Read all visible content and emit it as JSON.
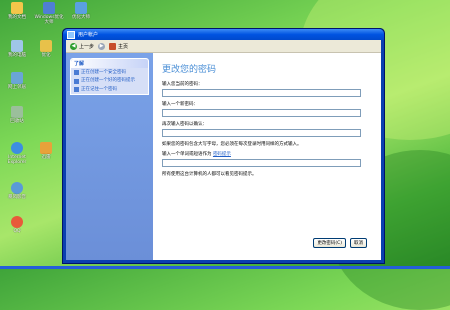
{
  "desktop": {
    "icons": [
      {
        "label": "我的文档",
        "color": "#f3c64a"
      },
      {
        "label": "Windows优化大师",
        "color": "#4f7fd4"
      },
      {
        "label": "优化大师",
        "color": "#5aa0e0"
      },
      {
        "label": "我的电脑",
        "color": "#9fc6e8"
      },
      {
        "label": "优化",
        "color": "#e8c14a"
      },
      {
        "label": "网上邻居",
        "color": "#6aa5d6"
      },
      {
        "label": "回收站",
        "color": "#9bbf9b"
      },
      {
        "label": "Internet Explorer",
        "color": "#3d8ee0"
      },
      {
        "label": "迅雷",
        "color": "#e8a23a"
      },
      {
        "label": "暴风影音",
        "color": "#5a9ad8"
      },
      {
        "label": "QQ",
        "color": "#e85a3a"
      }
    ]
  },
  "window": {
    "title": "用户帐户",
    "toolbar": {
      "back_label": "上一步",
      "home_label": "主页"
    },
    "task_pane": {
      "header": "了解",
      "items": [
        "正在创建一个安全密码",
        "正在创建一个好的密码提示",
        "正在记住一个密码"
      ]
    },
    "main": {
      "heading": "更改您的密码",
      "current_password_label": "输入您当前的密码：",
      "new_password_label": "输入一个新密码：",
      "confirm_password_label": "再次输入密码以确认：",
      "case_info": "如果您的密码包含大写字母，您必须在每次登录时用同样的方式输入。",
      "hint_label": "输入一个单词或短语作为",
      "hint_link": "密码提示",
      "hint_info": "所有使用这台计算机的人都可以看见密码提示。",
      "change_button": "更改密码(C)",
      "cancel_button": "取消"
    }
  },
  "colors": {
    "titlebar": "#0053e1",
    "heading": "#4b8fd6",
    "link": "#1f5fc8",
    "desktop": "#7ed957"
  }
}
